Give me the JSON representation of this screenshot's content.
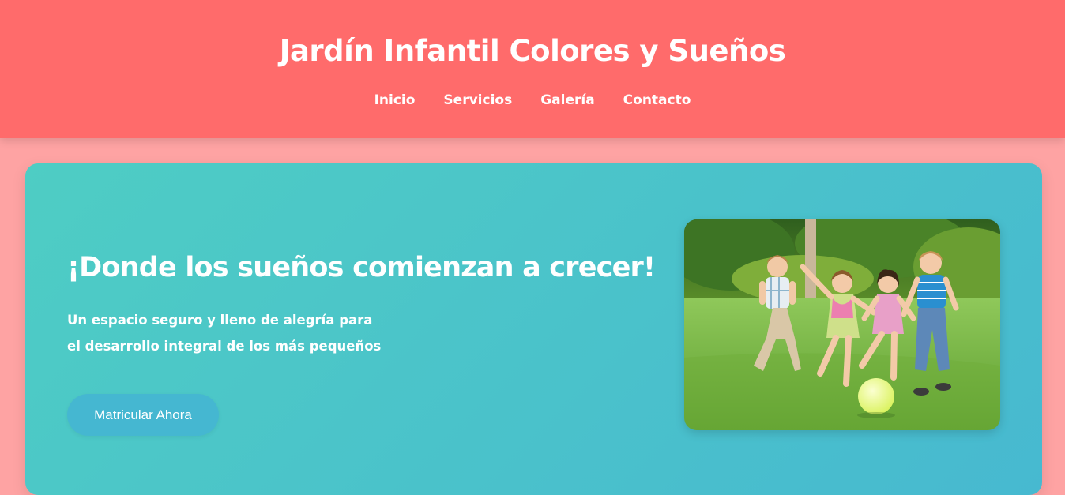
{
  "header": {
    "title": "Jardín Infantil Colores y Sueños",
    "nav": [
      {
        "label": "Inicio"
      },
      {
        "label": "Servicios"
      },
      {
        "label": "Galería"
      },
      {
        "label": "Contacto"
      }
    ]
  },
  "hero": {
    "title": "¡Donde los sueños comienzan a crecer!",
    "subtitle_line1": "Un espacio seguro y lleno de alegría para",
    "subtitle_line2": "el desarrollo integral de los más pequeños",
    "cta_label": "Matricular Ahora",
    "image_subject": "children-playing-ball-on-grass"
  },
  "colors": {
    "page_background": "#fea3a3",
    "header_background": "#ff6b6b",
    "hero_gradient_start": "#4ecdc4",
    "hero_gradient_end": "#47b9d0",
    "button_background": "#45b7d1",
    "text": "#ffffff"
  }
}
